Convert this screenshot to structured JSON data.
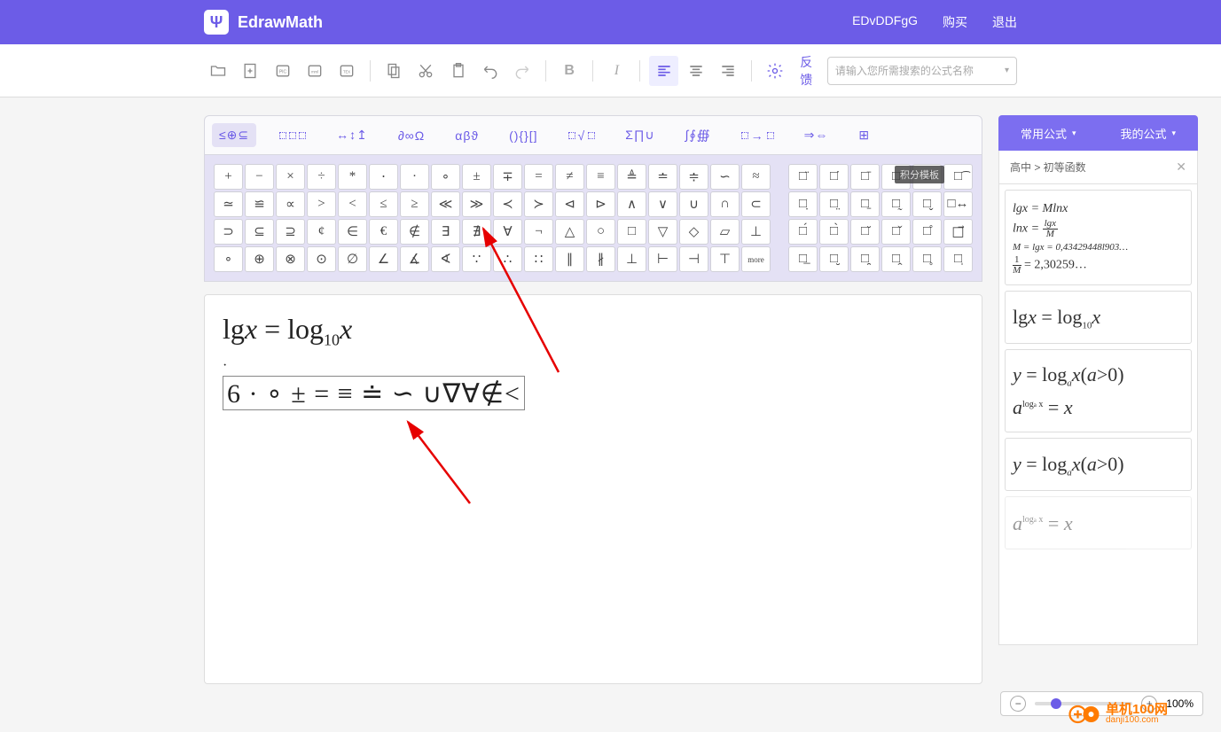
{
  "header": {
    "app_name": "EdrawMath",
    "user": "EDvDDFgG",
    "buy": "购买",
    "logout": "退出"
  },
  "toolbar": {
    "feedback": "反馈"
  },
  "search": {
    "placeholder": "请输入您所需搜索的公式名称"
  },
  "tabs": {
    "t1": "≤⊕⊆",
    "t2_a": "□̂",
    "t2_b": "□̃",
    "t2_c": "□̄",
    "t3": "↔↕↥",
    "t4": "∂∞Ω",
    "t5": "αβϑ",
    "t6": "(){}[]",
    "t7_a": "□/□",
    "t7_b": "√□",
    "t7_c": "□ⁿ",
    "t8": "Σ∏∪",
    "t9": "∫∮∰",
    "t10_a": "□→",
    "t10_b": "□̂",
    "t10_c": "⊠",
    "t11": "⇒⇔",
    "t12": "⊞"
  },
  "tooltip": "积分模板",
  "symbols_main": [
    [
      "+",
      "−",
      "×",
      "÷",
      "*",
      "⋅",
      "·",
      "∘",
      "±",
      "∓",
      "=",
      "≠",
      "≡",
      "≜",
      "≐",
      "≑",
      "∽",
      "≈"
    ],
    [
      "≃",
      "≌",
      "∝",
      "&gt;",
      "&lt;",
      "≤",
      "≥",
      "≪",
      "≫",
      "≺",
      "≻",
      "⊲",
      "⊳",
      "∧",
      "∨",
      "∪",
      "∩",
      "⊂"
    ],
    [
      "⊃",
      "⊆",
      "⊇",
      "¢",
      "∈",
      "€",
      "∉",
      "∃",
      "∄",
      "∀",
      "¬",
      "△",
      "○",
      "□",
      "▽",
      "◇",
      "▱",
      "⊥"
    ],
    [
      "∘",
      "⊕",
      "⊗",
      "⊙",
      "∅",
      "∠",
      "∡",
      "∢",
      "∵",
      "∴",
      "∷",
      "∥",
      "∦",
      "⊥",
      "⊢",
      "⊣",
      "⊤",
      "more"
    ]
  ],
  "symbols_side": [
    [
      "□̈",
      "□̇",
      "□̄",
      "□̃",
      "□̂",
      "□͡"
    ],
    [
      "□̣",
      "□̤",
      "□̱",
      "□̰",
      "□̬",
      "□↔"
    ],
    [
      "□́",
      "□̀",
      "□̆",
      "□̌",
      "□̊",
      "□⃗"
    ],
    [
      "□̲",
      "□̮",
      "□̯",
      "□̭",
      "□̥",
      "□̩"
    ]
  ],
  "editor": {
    "line1_a": "lg",
    "line1_b": "x",
    "line1_c": "=",
    "line1_d": "log",
    "line1_e": "10",
    "line1_f": "x",
    "dot": "·",
    "line2": "6 · ∘ ± = ≡ ≐ ∽ ∪∇∀∉&lt;"
  },
  "right_panel": {
    "tab_common": "常用公式",
    "tab_mine": "我的公式",
    "breadcrumb": "高中 > 初等函数",
    "cards": {
      "c1_l1": "lgx = Mlnx",
      "c1_l2_a": "lnx = ",
      "c1_l2_frac_t": "lgx",
      "c1_l2_frac_b": "M",
      "c1_l3": "M = lgx = 0,43429448l903…",
      "c1_l4_frac_t": "1",
      "c1_l4_frac_b": "M",
      "c1_l4_b": " = 2,30259…",
      "c2": "lgx = log₁₀x",
      "c3_l1": "y = logₐx (a>0)",
      "c3_l2_a": "a",
      "c3_l2_sup": "logₐx",
      "c3_l2_b": " = x",
      "c4": "y = logₐx (a>0)",
      "c5_a": "a",
      "c5_sup": "logₐx",
      "c5_b": " = x"
    }
  },
  "zoom": {
    "percent": "100%"
  },
  "watermark": {
    "line1": "单机100网",
    "line2": "danji100.com"
  }
}
